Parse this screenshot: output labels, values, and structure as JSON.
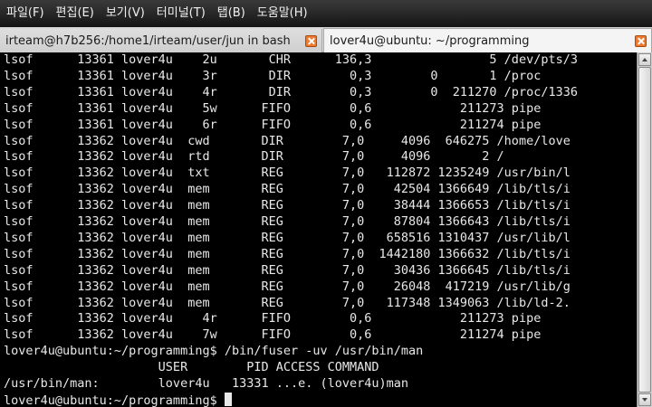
{
  "menubar": {
    "items": [
      "파일(F)",
      "편집(E)",
      "보기(V)",
      "터미널(T)",
      "탭(B)",
      "도움말(H)"
    ]
  },
  "tabs": [
    {
      "label": "irteam@h7b256:/home1/irteam/user/jun in bash",
      "active": false
    },
    {
      "label": "lover4u@ubuntu: ~/programming",
      "active": true
    }
  ],
  "terminal": {
    "lines": [
      "lsof      13361 lover4u    2u       CHR      136,3                5 /dev/pts/3",
      "lsof      13361 lover4u    3r       DIR        0,3        0       1 /proc",
      "lsof      13361 lover4u    4r       DIR        0,3        0  211270 /proc/1336",
      "lsof      13361 lover4u    5w      FIFO        0,6            211273 pipe",
      "lsof      13361 lover4u    6r      FIFO        0,6            211274 pipe",
      "lsof      13362 lover4u  cwd       DIR        7,0     4096  646275 /home/love",
      "lsof      13362 lover4u  rtd       DIR        7,0     4096       2 /",
      "lsof      13362 lover4u  txt       REG        7,0   112872 1235249 /usr/bin/l",
      "lsof      13362 lover4u  mem       REG        7,0    42504 1366649 /lib/tls/i",
      "lsof      13362 lover4u  mem       REG        7,0    38444 1366653 /lib/tls/i",
      "lsof      13362 lover4u  mem       REG        7,0    87804 1366643 /lib/tls/i",
      "lsof      13362 lover4u  mem       REG        7,0   658516 1310437 /usr/lib/l",
      "lsof      13362 lover4u  mem       REG        7,0  1442180 1366632 /lib/tls/i",
      "lsof      13362 lover4u  mem       REG        7,0    30436 1366645 /lib/tls/i",
      "lsof      13362 lover4u  mem       REG        7,0    26048  417219 /usr/lib/g",
      "lsof      13362 lover4u  mem       REG        7,0   117348 1349063 /lib/ld-2.",
      "lsof      13362 lover4u    4r      FIFO        0,6            211273 pipe",
      "lsof      13362 lover4u    7w      FIFO        0,6            211274 pipe",
      "lover4u@ubuntu:~/programming$ /bin/fuser -uv /usr/bin/man",
      "                     USER        PID ACCESS COMMAND",
      "/usr/bin/man:        lover4u   13331 ...e. (lover4u)man",
      "lover4u@ubuntu:~/programming$ "
    ]
  },
  "colors": {
    "terminal_bg": "#000000",
    "terminal_fg": "#e8e8e8",
    "menubar_bg": "#1f1f1f",
    "tab_close": "#ee7a2f"
  }
}
